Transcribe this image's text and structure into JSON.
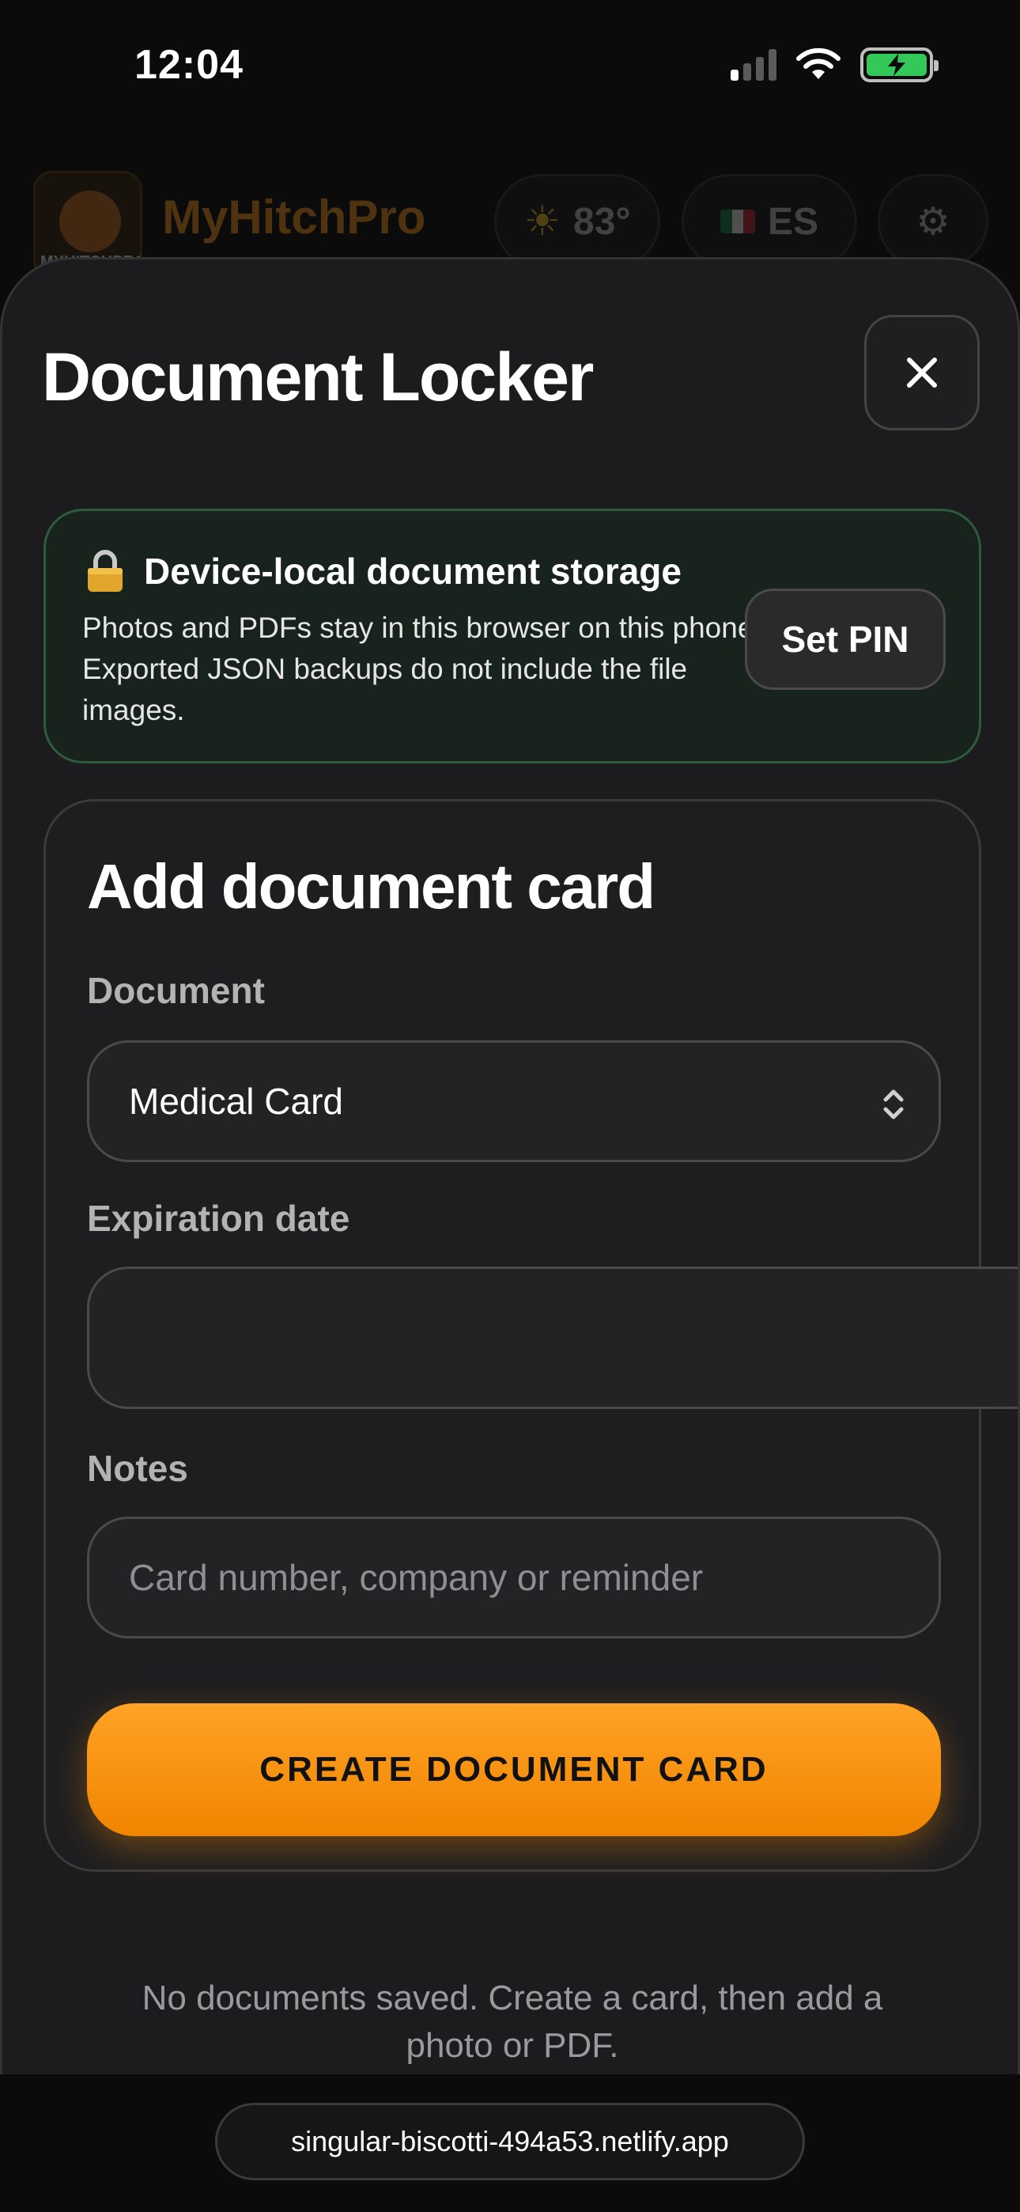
{
  "status_bar": {
    "time": "12:04"
  },
  "background_header": {
    "logo_text": "MYHITCHPRO",
    "app_title": "MyHitchPro",
    "weather": "83°",
    "language": "ES"
  },
  "modal": {
    "title": "Document Locker",
    "banner": {
      "title": "Device-local document storage",
      "description": "Photos and PDFs stay in this browser on this phone. Exported JSON backups do not include the file images.",
      "set_pin_label": "Set PIN"
    },
    "form": {
      "title": "Add document card",
      "document_label": "Document",
      "document_value": "Medical Card",
      "expiration_label": "Expiration date",
      "expiration_value": "",
      "notes_label": "Notes",
      "notes_placeholder": "Card number, company or reminder",
      "create_label": "CREATE DOCUMENT CARD"
    },
    "empty_state": "No documents saved. Create a card, then add a photo or PDF."
  },
  "browser": {
    "url": "singular-biscotti-494a53.netlify.app"
  },
  "colors": {
    "accent": "#f5921b",
    "banner_border": "#2f5a3b",
    "sheet_bg": "#1c1c1e"
  }
}
